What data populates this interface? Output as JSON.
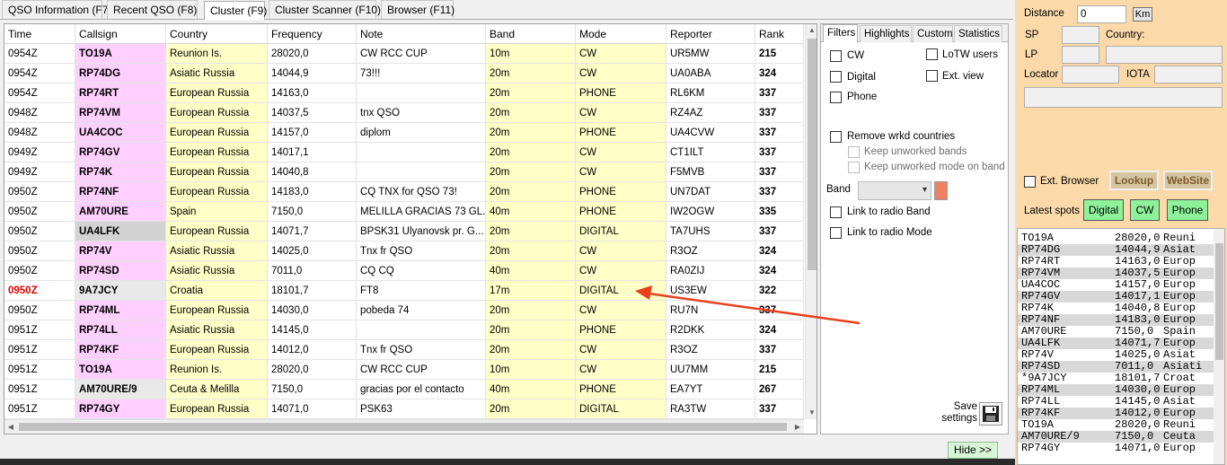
{
  "main_tabs": [
    "QSO Information (F7)",
    "Recent QSO (F8)",
    "Cluster (F9)",
    "Cluster Scanner (F10)",
    "Browser (F11)"
  ],
  "columns": [
    "Time",
    "Callsign",
    "Country",
    "Frequency",
    "Note",
    "Band",
    "Mode",
    "Reporter",
    "Rank"
  ],
  "rows": [
    {
      "time": "0954Z",
      "call": "TO19A",
      "country": "Reunion Is.",
      "freq": "28020,0",
      "note": "CW RCC CUP",
      "band": "10m",
      "mode": "CW",
      "reporter": "UR5MW",
      "rank": "215"
    },
    {
      "time": "0954Z",
      "call": "RP74DG",
      "country": "Asiatic Russia",
      "freq": "14044,9",
      "note": "73!!!",
      "band": "20m",
      "mode": "CW",
      "reporter": "UA0ABA",
      "rank": "324"
    },
    {
      "time": "0954Z",
      "call": "RP74RT",
      "country": "European Russia",
      "freq": "14163,0",
      "note": "",
      "band": "20m",
      "mode": "PHONE",
      "reporter": "RL6KM",
      "rank": "337"
    },
    {
      "time": "0948Z",
      "call": "RP74VM",
      "country": "European Russia",
      "freq": "14037,5",
      "note": "tnx QSO",
      "band": "20m",
      "mode": "CW",
      "reporter": "RZ4AZ",
      "rank": "337"
    },
    {
      "time": "0948Z",
      "call": "UA4COC",
      "country": "European Russia",
      "freq": "14157,0",
      "note": "diplom",
      "band": "20m",
      "mode": "PHONE",
      "reporter": "UA4CVW",
      "rank": "337"
    },
    {
      "time": "0949Z",
      "call": "RP74GV",
      "country": "European Russia",
      "freq": "14017,1",
      "note": "",
      "band": "20m",
      "mode": "CW",
      "reporter": "CT1ILT",
      "rank": "337"
    },
    {
      "time": "0949Z",
      "call": "RP74K",
      "country": "European Russia",
      "freq": "14040,8",
      "note": "",
      "band": "20m",
      "mode": "CW",
      "reporter": "F5MVB",
      "rank": "337"
    },
    {
      "time": "0950Z",
      "call": "RP74NF",
      "country": "European Russia",
      "freq": "14183,0",
      "note": "CQ TNX for QSO 73!",
      "band": "20m",
      "mode": "PHONE",
      "reporter": "UN7DAT",
      "rank": "337"
    },
    {
      "time": "0950Z",
      "call": "AM70URE",
      "country": "Spain",
      "freq": "7150,0",
      "note": "MELILLA GRACIAS 73 GL.",
      "band": "40m",
      "mode": "PHONE",
      "reporter": "IW2OGW",
      "rank": "335"
    },
    {
      "time": "0950Z",
      "call": "UA4LFK",
      "country": "European Russia",
      "freq": "14071,7",
      "note": "BPSK31 Ulyanovsk  pr. G...",
      "band": "20m",
      "mode": "DIGITAL",
      "reporter": "TA7UHS",
      "rank": "337"
    },
    {
      "time": "0950Z",
      "call": "RP74V",
      "country": "Asiatic Russia",
      "freq": "14025,0",
      "note": "Tnx fr QSO",
      "band": "20m",
      "mode": "CW",
      "reporter": "R3OZ",
      "rank": "324"
    },
    {
      "time": "0950Z",
      "call": "RP74SD",
      "country": "Asiatic Russia",
      "freq": "7011,0",
      "note": "CQ CQ",
      "band": "40m",
      "mode": "CW",
      "reporter": "RA0ZIJ",
      "rank": "324"
    },
    {
      "time": "0950Z",
      "call": "9A7JCY",
      "country": "Croatia",
      "freq": "18101,7",
      "note": "FT8",
      "band": "17m",
      "mode": "DIGITAL",
      "reporter": "US3EW",
      "rank": "322"
    },
    {
      "time": "0950Z",
      "call": "RP74ML",
      "country": "European Russia",
      "freq": "14030,0",
      "note": "pobeda 74",
      "band": "20m",
      "mode": "CW",
      "reporter": "RU7N",
      "rank": "337"
    },
    {
      "time": "0951Z",
      "call": "RP74LL",
      "country": "Asiatic Russia",
      "freq": "14145,0",
      "note": "",
      "band": "20m",
      "mode": "PHONE",
      "reporter": "R2DKK",
      "rank": "324"
    },
    {
      "time": "0951Z",
      "call": "RP74KF",
      "country": "European Russia",
      "freq": "14012,0",
      "note": "Tnx fr QSO",
      "band": "20m",
      "mode": "CW",
      "reporter": "R3OZ",
      "rank": "337"
    },
    {
      "time": "0951Z",
      "call": "TO19A",
      "country": "Reunion Is.",
      "freq": "28020,0",
      "note": "CW RCC CUP",
      "band": "10m",
      "mode": "CW",
      "reporter": "UU7MM",
      "rank": "215"
    },
    {
      "time": "0951Z",
      "call": "AM70URE/9",
      "country": "Ceuta & Melilla",
      "freq": "7150,0",
      "note": "gracias por el contacto",
      "band": "40m",
      "mode": "PHONE",
      "reporter": "EA7YT",
      "rank": "267"
    },
    {
      "time": "0951Z",
      "call": "RP74GY",
      "country": "European Russia",
      "freq": "14071,0",
      "note": "PSK63",
      "band": "20m",
      "mode": "DIGITAL",
      "reporter": "RA3TW",
      "rank": "337"
    }
  ],
  "filter_tabs": [
    "Filters",
    "Highlights",
    "Custom",
    "Statistics"
  ],
  "filters": {
    "cw": "CW",
    "digital": "Digital",
    "phone": "Phone",
    "lotw": "LoTW users",
    "ext_view": "Ext. view",
    "remove_wrkd": "Remove wrkd countries",
    "keep_bands": "Keep unworked bands",
    "keep_mode": "Keep unworked mode on band",
    "band_label": "Band",
    "link_band": "Link to radio Band",
    "link_mode": "Link to radio Mode",
    "save_settings": "Save settings"
  },
  "info": {
    "distance_label": "Distance",
    "distance_value": "0",
    "km": "Km",
    "sp": "SP",
    "lp": "LP",
    "country_label": "Country:",
    "locator": "Locator",
    "iota": "IOTA",
    "ext_browser": "Ext. Browser",
    "lookup": "Lookup",
    "website": "WebSite",
    "latest_spots": "Latest spots",
    "btn_digital": "Digital",
    "btn_cw": "CW",
    "btn_phone": "Phone"
  },
  "spots": [
    {
      "call": "TO19A",
      "freq": "28020,0",
      "country": "Reuni"
    },
    {
      "call": "RP74DG",
      "freq": "14044,9",
      "country": "Asiat"
    },
    {
      "call": "RP74RT",
      "freq": "14163,0",
      "country": "Europ"
    },
    {
      "call": "RP74VM",
      "freq": "14037,5",
      "country": "Europ"
    },
    {
      "call": "UA4COC",
      "freq": "14157,0",
      "country": "Europ"
    },
    {
      "call": "RP74GV",
      "freq": "14017,1",
      "country": "Europ"
    },
    {
      "call": "RP74K",
      "freq": "14040,8",
      "country": "Europ"
    },
    {
      "call": "RP74NF",
      "freq": "14183,0",
      "country": "Europ"
    },
    {
      "call": "AM70URE",
      "freq": "7150,0",
      "country": "Spain"
    },
    {
      "call": "UA4LFK",
      "freq": "14071,7",
      "country": "Europ"
    },
    {
      "call": "RP74V",
      "freq": "14025,0",
      "country": "Asiat"
    },
    {
      "call": "RP74SD",
      "freq": "7011,0",
      "country": "Asiati"
    },
    {
      "call": "*9A7JCY",
      "freq": "18101,7",
      "country": "Croat"
    },
    {
      "call": "RP74ML",
      "freq": "14030,0",
      "country": "Europ"
    },
    {
      "call": "RP74LL",
      "freq": "14145,0",
      "country": "Asiat"
    },
    {
      "call": "RP74KF",
      "freq": "14012,0",
      "country": "Europ"
    },
    {
      "call": "TO19A",
      "freq": "28020,0",
      "country": "Reuni"
    },
    {
      "call": "AM70URE/9",
      "freq": "7150,0",
      "country": "Ceuta"
    },
    {
      "call": "RP74GY",
      "freq": "14071,0",
      "country": "Europ"
    }
  ],
  "hide_button": "Hide >>",
  "colors": {
    "callsign_bg": "#ffd0ff",
    "yellow_cell": "#ffffc8",
    "highlight_time": "#e00000",
    "right_panel": "#fcd9a9",
    "annotation_arrow": "#e8401c"
  }
}
